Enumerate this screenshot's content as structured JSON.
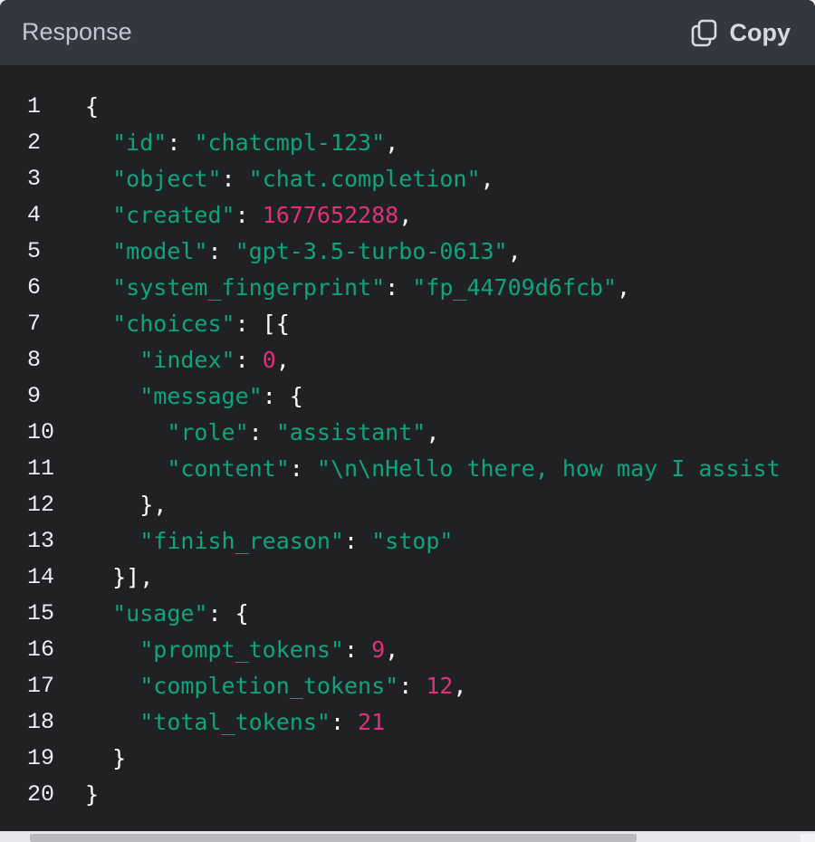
{
  "header": {
    "title": "Response",
    "copy_label": "Copy",
    "copy_icon": "copy-icon"
  },
  "colors": {
    "panel_background": "#202123",
    "header_background": "#353740",
    "string": "#10a37f",
    "number": "#df3079",
    "punctuation": "#ffffff",
    "line_number": "#ececf1"
  },
  "code": {
    "language": "json",
    "lines": [
      {
        "num": "1",
        "tokens": [
          {
            "t": "p",
            "v": "{"
          }
        ]
      },
      {
        "num": "2",
        "tokens": [
          {
            "t": "p",
            "v": "  "
          },
          {
            "t": "s",
            "v": "\"id\""
          },
          {
            "t": "p",
            "v": ": "
          },
          {
            "t": "s",
            "v": "\"chatcmpl-123\""
          },
          {
            "t": "p",
            "v": ","
          }
        ]
      },
      {
        "num": "3",
        "tokens": [
          {
            "t": "p",
            "v": "  "
          },
          {
            "t": "s",
            "v": "\"object\""
          },
          {
            "t": "p",
            "v": ": "
          },
          {
            "t": "s",
            "v": "\"chat.completion\""
          },
          {
            "t": "p",
            "v": ","
          }
        ]
      },
      {
        "num": "4",
        "tokens": [
          {
            "t": "p",
            "v": "  "
          },
          {
            "t": "s",
            "v": "\"created\""
          },
          {
            "t": "p",
            "v": ": "
          },
          {
            "t": "n",
            "v": "1677652288"
          },
          {
            "t": "p",
            "v": ","
          }
        ]
      },
      {
        "num": "5",
        "tokens": [
          {
            "t": "p",
            "v": "  "
          },
          {
            "t": "s",
            "v": "\"model\""
          },
          {
            "t": "p",
            "v": ": "
          },
          {
            "t": "s",
            "v": "\"gpt-3.5-turbo-0613\""
          },
          {
            "t": "p",
            "v": ","
          }
        ]
      },
      {
        "num": "6",
        "tokens": [
          {
            "t": "p",
            "v": "  "
          },
          {
            "t": "s",
            "v": "\"system_fingerprint\""
          },
          {
            "t": "p",
            "v": ": "
          },
          {
            "t": "s",
            "v": "\"fp_44709d6fcb\""
          },
          {
            "t": "p",
            "v": ","
          }
        ]
      },
      {
        "num": "7",
        "tokens": [
          {
            "t": "p",
            "v": "  "
          },
          {
            "t": "s",
            "v": "\"choices\""
          },
          {
            "t": "p",
            "v": ": [{"
          }
        ]
      },
      {
        "num": "8",
        "tokens": [
          {
            "t": "p",
            "v": "    "
          },
          {
            "t": "s",
            "v": "\"index\""
          },
          {
            "t": "p",
            "v": ": "
          },
          {
            "t": "n",
            "v": "0"
          },
          {
            "t": "p",
            "v": ","
          }
        ]
      },
      {
        "num": "9",
        "tokens": [
          {
            "t": "p",
            "v": "    "
          },
          {
            "t": "s",
            "v": "\"message\""
          },
          {
            "t": "p",
            "v": ": {"
          }
        ]
      },
      {
        "num": "10",
        "tokens": [
          {
            "t": "p",
            "v": "      "
          },
          {
            "t": "s",
            "v": "\"role\""
          },
          {
            "t": "p",
            "v": ": "
          },
          {
            "t": "s",
            "v": "\"assistant\""
          },
          {
            "t": "p",
            "v": ","
          }
        ]
      },
      {
        "num": "11",
        "tokens": [
          {
            "t": "p",
            "v": "      "
          },
          {
            "t": "s",
            "v": "\"content\""
          },
          {
            "t": "p",
            "v": ": "
          },
          {
            "t": "s",
            "v": "\"\\n\\nHello there, how may I assist"
          }
        ]
      },
      {
        "num": "12",
        "tokens": [
          {
            "t": "p",
            "v": "    },"
          }
        ]
      },
      {
        "num": "13",
        "tokens": [
          {
            "t": "p",
            "v": "    "
          },
          {
            "t": "s",
            "v": "\"finish_reason\""
          },
          {
            "t": "p",
            "v": ": "
          },
          {
            "t": "s",
            "v": "\"stop\""
          }
        ]
      },
      {
        "num": "14",
        "tokens": [
          {
            "t": "p",
            "v": "  }],"
          }
        ]
      },
      {
        "num": "15",
        "tokens": [
          {
            "t": "p",
            "v": "  "
          },
          {
            "t": "s",
            "v": "\"usage\""
          },
          {
            "t": "p",
            "v": ": {"
          }
        ]
      },
      {
        "num": "16",
        "tokens": [
          {
            "t": "p",
            "v": "    "
          },
          {
            "t": "s",
            "v": "\"prompt_tokens\""
          },
          {
            "t": "p",
            "v": ": "
          },
          {
            "t": "n",
            "v": "9"
          },
          {
            "t": "p",
            "v": ","
          }
        ]
      },
      {
        "num": "17",
        "tokens": [
          {
            "t": "p",
            "v": "    "
          },
          {
            "t": "s",
            "v": "\"completion_tokens\""
          },
          {
            "t": "p",
            "v": ": "
          },
          {
            "t": "n",
            "v": "12"
          },
          {
            "t": "p",
            "v": ","
          }
        ]
      },
      {
        "num": "18",
        "tokens": [
          {
            "t": "p",
            "v": "    "
          },
          {
            "t": "s",
            "v": "\"total_tokens\""
          },
          {
            "t": "p",
            "v": ": "
          },
          {
            "t": "n",
            "v": "21"
          }
        ]
      },
      {
        "num": "19",
        "tokens": [
          {
            "t": "p",
            "v": "  }"
          }
        ]
      },
      {
        "num": "20",
        "tokens": [
          {
            "t": "p",
            "v": "}"
          }
        ]
      }
    ]
  },
  "scrollbar": {
    "visible_fraction": 0.75,
    "scroll_position": 0
  }
}
